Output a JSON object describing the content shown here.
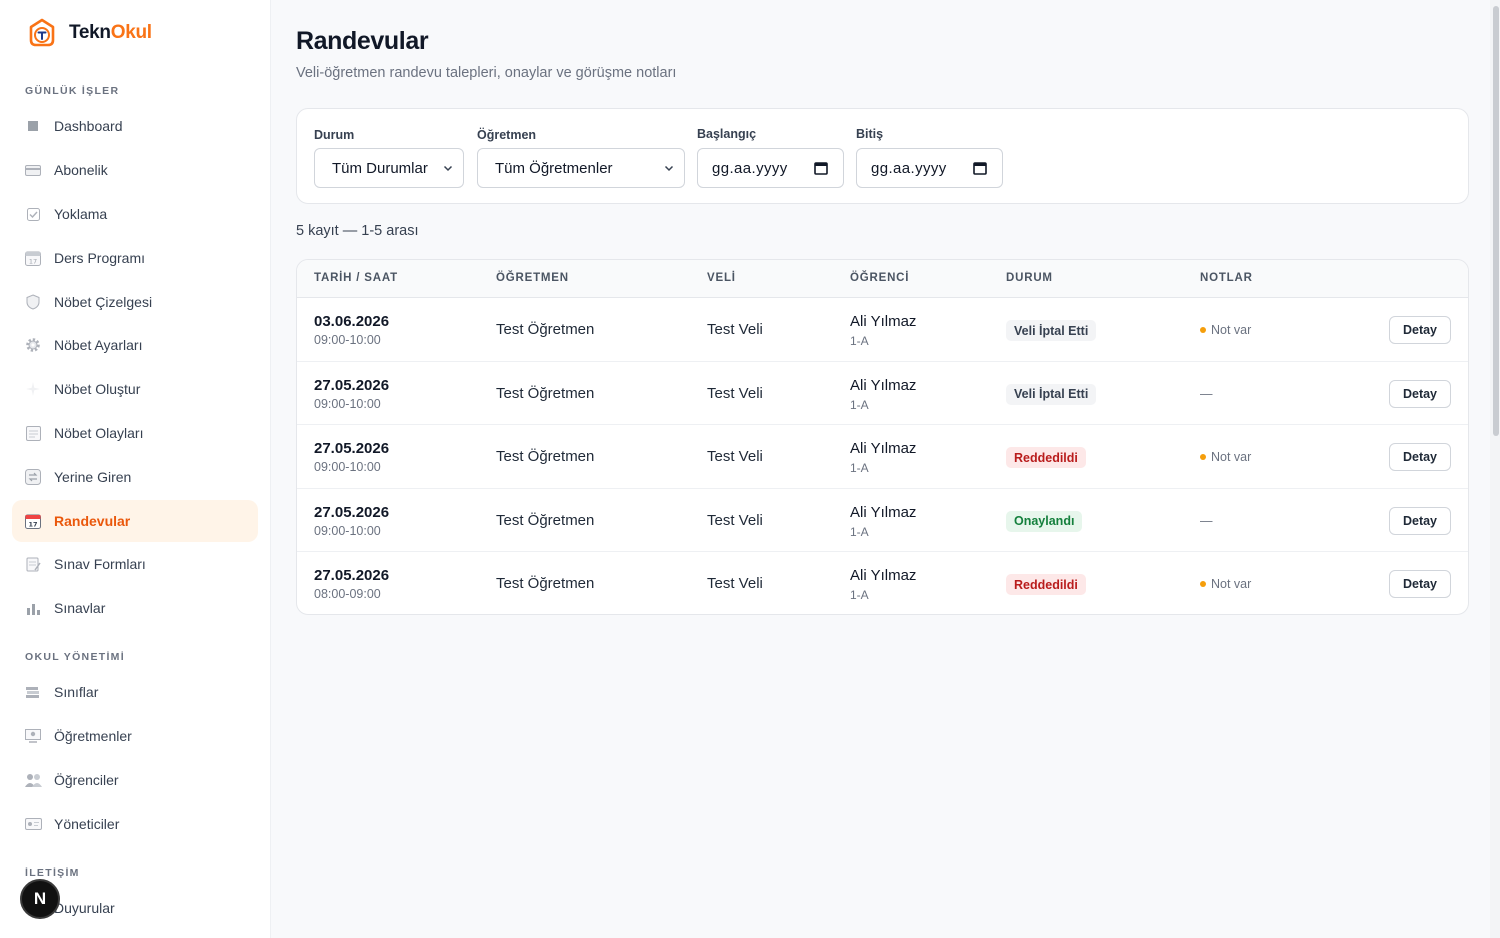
{
  "brand": {
    "name_part1": "Tekn",
    "name_part2": "Okul",
    "accent": "#f97316"
  },
  "sidebar": {
    "sections": [
      {
        "title": "GÜNLÜK İŞLER",
        "items": [
          {
            "label": "Dashboard",
            "icon": "square-icon"
          },
          {
            "label": "Abonelik",
            "icon": "card-icon"
          },
          {
            "label": "Yoklama",
            "icon": "checkbox-icon"
          },
          {
            "label": "Ders Programı",
            "icon": "calendar-icon"
          },
          {
            "label": "Nöbet Çizelgesi",
            "icon": "shield-icon"
          },
          {
            "label": "Nöbet Ayarları",
            "icon": "gear-icon"
          },
          {
            "label": "Nöbet Oluştur",
            "icon": "sparkle-icon"
          },
          {
            "label": "Nöbet Olayları",
            "icon": "list-icon"
          },
          {
            "label": "Yerine Giren",
            "icon": "swap-icon"
          },
          {
            "label": "Randevular",
            "icon": "calendar-icon",
            "active": true
          },
          {
            "label": "Sınav Formları",
            "icon": "memo-icon"
          },
          {
            "label": "Sınavlar",
            "icon": "bar-chart-icon"
          }
        ]
      },
      {
        "title": "OKUL YÖNETİMİ",
        "items": [
          {
            "label": "Sınıflar",
            "icon": "books-icon"
          },
          {
            "label": "Öğretmenler",
            "icon": "teacher-icon"
          },
          {
            "label": "Öğrenciler",
            "icon": "users-icon"
          },
          {
            "label": "Yöneticiler",
            "icon": "id-card-icon"
          }
        ]
      },
      {
        "title": "İLETİŞİM",
        "items": [
          {
            "label": "Duyurular",
            "icon": "megaphone-icon"
          }
        ]
      }
    ]
  },
  "header": {
    "title": "Randevular",
    "subtitle": "Veli-öğretmen randevu talepleri, onaylar ve görüşme notları"
  },
  "filters": {
    "status": {
      "label": "Durum",
      "value": "Tüm Durumlar"
    },
    "teacher": {
      "label": "Öğretmen",
      "value": "Tüm Öğretmenler"
    },
    "start": {
      "label": "Başlangıç",
      "value": "gg.aa.yyyy"
    },
    "end": {
      "label": "Bitiş",
      "value": "gg.aa.yyyy"
    }
  },
  "record_count": "5 kayıt — 1-5 arası",
  "table": {
    "columns": [
      "TARİH / SAAT",
      "ÖĞRETMEN",
      "VELİ",
      "ÖĞRENCİ",
      "DURUM",
      "NOTLAR"
    ],
    "rows": [
      {
        "date": "03.06.2026",
        "time": "09:00-10:00",
        "teacher": "Test Öğretmen",
        "parent": "Test Veli",
        "student": "Ali Yılmaz",
        "class": "1-A",
        "status": "Veli İptal Etti",
        "status_kind": "cancelled",
        "notes": "Not var",
        "has_note": true,
        "action": "Detay"
      },
      {
        "date": "27.05.2026",
        "time": "09:00-10:00",
        "teacher": "Test Öğretmen",
        "parent": "Test Veli",
        "student": "Ali Yılmaz",
        "class": "1-A",
        "status": "Veli İptal Etti",
        "status_kind": "cancelled",
        "notes": "—",
        "has_note": false,
        "action": "Detay"
      },
      {
        "date": "27.05.2026",
        "time": "09:00-10:00",
        "teacher": "Test Öğretmen",
        "parent": "Test Veli",
        "student": "Ali Yılmaz",
        "class": "1-A",
        "status": "Reddedildi",
        "status_kind": "rejected",
        "notes": "Not var",
        "has_note": true,
        "action": "Detay"
      },
      {
        "date": "27.05.2026",
        "time": "09:00-10:00",
        "teacher": "Test Öğretmen",
        "parent": "Test Veli",
        "student": "Ali Yılmaz",
        "class": "1-A",
        "status": "Onaylandı",
        "status_kind": "approved",
        "notes": "—",
        "has_note": false,
        "action": "Detay"
      },
      {
        "date": "27.05.2026",
        "time": "08:00-09:00",
        "teacher": "Test Öğretmen",
        "parent": "Test Veli",
        "student": "Ali Yılmaz",
        "class": "1-A",
        "status": "Reddedildi",
        "status_kind": "rejected",
        "notes": "Not var",
        "has_note": true,
        "action": "Detay"
      }
    ]
  },
  "status_colors": {
    "cancelled": {
      "bg": "#f3f4f6",
      "fg": "#374151"
    },
    "rejected": {
      "bg": "#fde8e8",
      "fg": "#b91c1c"
    },
    "approved": {
      "bg": "#e7f6ec",
      "fg": "#15803d"
    }
  },
  "fab": {
    "label": "N"
  }
}
